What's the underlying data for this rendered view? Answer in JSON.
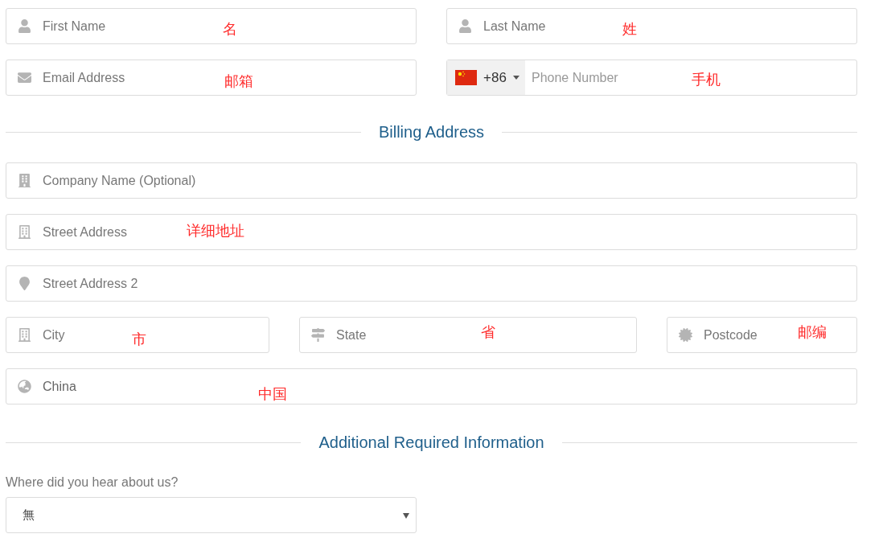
{
  "contact_rows": [
    [
      {
        "kind": "first_name",
        "placeholder": "First Name",
        "annotation": "名"
      },
      {
        "kind": "last_name",
        "placeholder": "Last Name",
        "annotation": "姓"
      }
    ],
    [
      {
        "kind": "email",
        "placeholder": "Email Address",
        "annotation": "邮箱"
      },
      {
        "kind": "phone",
        "country_code": "+86",
        "placeholder": "Phone Number",
        "annotation": "手机"
      }
    ]
  ],
  "billing": {
    "heading": "Billing Address",
    "rows": [
      [
        {
          "kind": "company",
          "placeholder": "Company Name (Optional)"
        }
      ],
      [
        {
          "kind": "street",
          "placeholder": "Street Address",
          "annotation": "详细地址"
        }
      ],
      [
        {
          "kind": "street2",
          "placeholder": "Street Address 2"
        }
      ],
      [
        {
          "kind": "city",
          "placeholder": "City",
          "annotation": "市"
        },
        {
          "kind": "state",
          "placeholder": "State",
          "annotation": "省"
        },
        {
          "kind": "postcode",
          "placeholder": "Postcode",
          "annotation": "邮编"
        }
      ],
      [
        {
          "kind": "country",
          "value": "China",
          "annotation": "中国"
        }
      ]
    ]
  },
  "additional": {
    "heading": "Additional Required Information",
    "question": "Where did you hear about us?",
    "answer": "無"
  }
}
